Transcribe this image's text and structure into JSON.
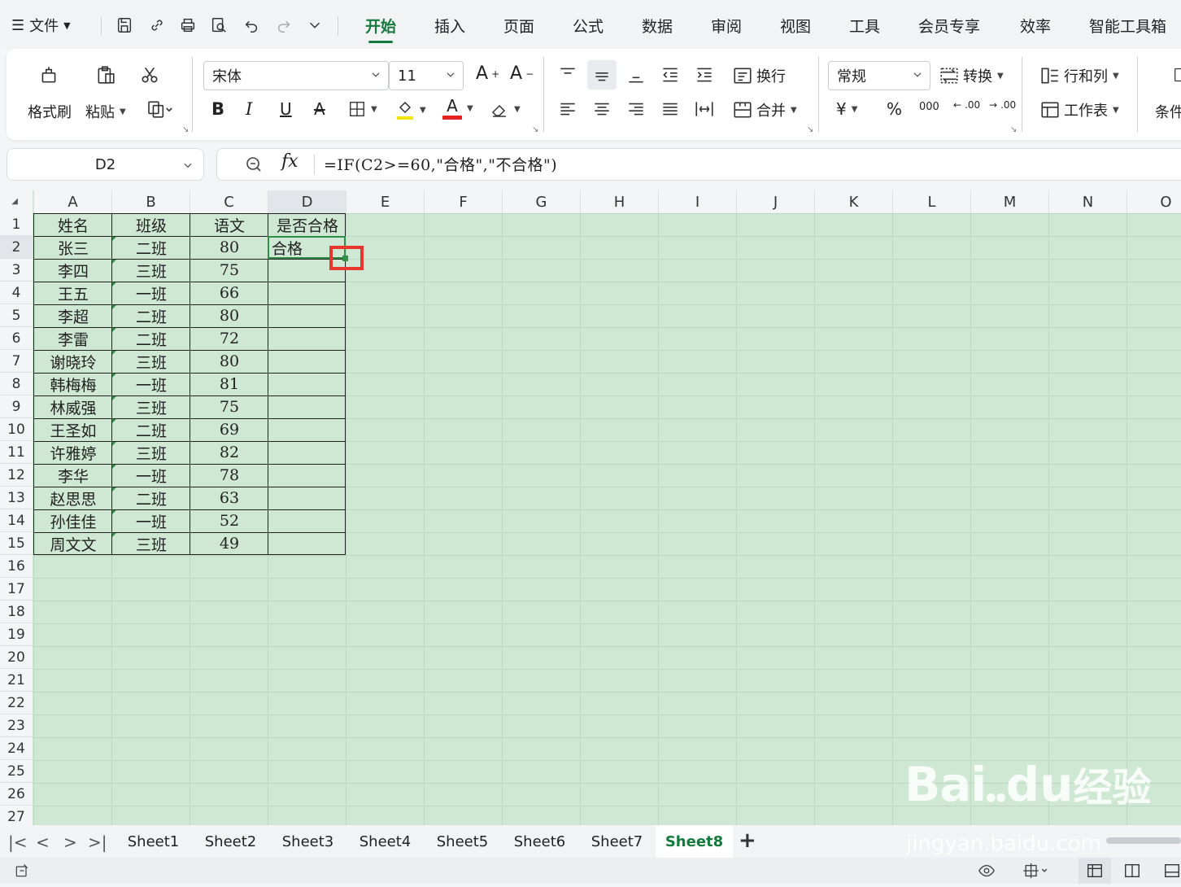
{
  "menu": {
    "file_label": "文件",
    "tabs": [
      "开始",
      "插入",
      "页面",
      "公式",
      "数据",
      "审阅",
      "视图",
      "工具",
      "会员专享",
      "效率",
      "智能工具箱"
    ],
    "active_tab": "开始"
  },
  "ribbon": {
    "format_painter": "格式刷",
    "paste": "粘贴",
    "font_name": "宋体",
    "font_size": "11",
    "wrap": "换行",
    "merge": "合并",
    "number_format": "常规",
    "convert": "转换",
    "row_col": "行和列",
    "worksheet": "工作表",
    "conditional": "条件",
    "bold": "B",
    "italic": "I",
    "underline": "U",
    "strike": "A",
    "font_color": "A",
    "percent": "%",
    "thousands": "000",
    "currency": "¥",
    "inc_decimal": ".00",
    "dec_decimal": ".00"
  },
  "formula_bar": {
    "name_box": "D2",
    "fx_label": "fx",
    "formula": "=IF(C2>=60,\"合格\",\"不合格\")"
  },
  "grid": {
    "columns": [
      "A",
      "B",
      "C",
      "D",
      "E",
      "F",
      "G",
      "H",
      "I",
      "J",
      "K",
      "L",
      "M",
      "N",
      "O"
    ],
    "rows": [
      "1",
      "2",
      "3",
      "4",
      "5",
      "6",
      "7",
      "8",
      "9",
      "10",
      "11",
      "12",
      "13",
      "14",
      "15",
      "16",
      "17",
      "18",
      "19",
      "20",
      "21",
      "22",
      "23",
      "24",
      "25",
      "26",
      "27"
    ],
    "header": [
      "姓名",
      "班级",
      "语文",
      "是否合格"
    ],
    "data": [
      [
        "张三",
        "二班",
        "80",
        "合格"
      ],
      [
        "李四",
        "三班",
        "75",
        ""
      ],
      [
        "王五",
        "一班",
        "66",
        ""
      ],
      [
        "李超",
        "二班",
        "80",
        ""
      ],
      [
        "李雷",
        "二班",
        "72",
        ""
      ],
      [
        "谢晓玲",
        "三班",
        "80",
        ""
      ],
      [
        "韩梅梅",
        "一班",
        "81",
        ""
      ],
      [
        "林威强",
        "三班",
        "75",
        ""
      ],
      [
        "王圣如",
        "二班",
        "69",
        ""
      ],
      [
        "许雅婷",
        "三班",
        "82",
        ""
      ],
      [
        "李华",
        "一班",
        "78",
        ""
      ],
      [
        "赵思思",
        "二班",
        "63",
        ""
      ],
      [
        "孙佳佳",
        "一班",
        "52",
        ""
      ],
      [
        "周文文",
        "三班",
        "49",
        ""
      ]
    ],
    "selected_cell": "D2"
  },
  "sheets": {
    "tabs": [
      "Sheet1",
      "Sheet2",
      "Sheet3",
      "Sheet4",
      "Sheet5",
      "Sheet6",
      "Sheet7",
      "Sheet8"
    ],
    "active": "Sheet8",
    "add_label": "+"
  },
  "watermark": {
    "brand": "Bai",
    "brand2": "du",
    "cn": "经验",
    "url": "jingyan.baidu.com"
  },
  "colors": {
    "accent": "#147a3c",
    "grid_bg": "#cfe8d3",
    "highlight_red": "#e8372f"
  }
}
